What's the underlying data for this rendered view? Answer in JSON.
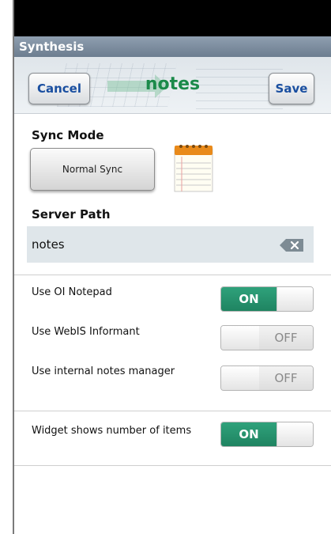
{
  "app": {
    "title": "Synthesis"
  },
  "header": {
    "title": "notes",
    "cancel_label": "Cancel",
    "save_label": "Save"
  },
  "sync": {
    "label": "Sync Mode",
    "value": "Normal Sync"
  },
  "server": {
    "label": "Server Path",
    "value": "notes"
  },
  "settings": [
    {
      "label": "Use OI Notepad",
      "state": "ON"
    },
    {
      "label": "Use WebIS Informant",
      "state": "OFF"
    },
    {
      "label": "Use internal notes manager",
      "state": "OFF"
    },
    {
      "label": "Widget shows number of items",
      "state": "ON"
    }
  ],
  "colors": {
    "accent": "#1b8a4a",
    "toggle_on": "#1f8461",
    "button_text": "#1a4fa0"
  },
  "icons": {
    "notepad": "notepad-icon",
    "clear": "clear-text-icon"
  }
}
